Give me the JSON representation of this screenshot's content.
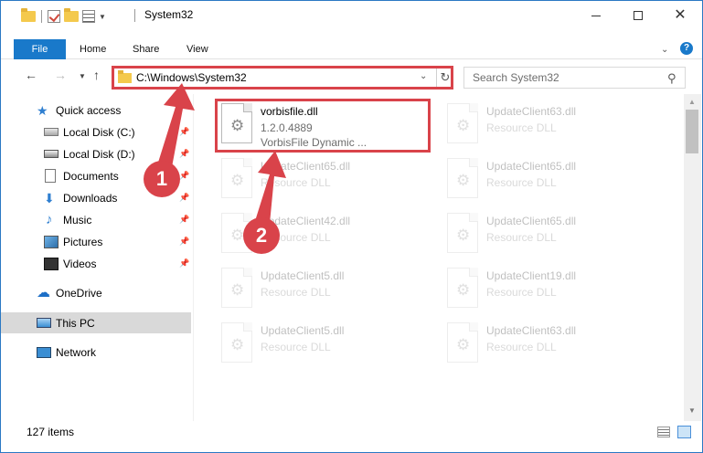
{
  "window": {
    "title": "System32"
  },
  "ribbon": {
    "tabs": [
      {
        "label": "File"
      },
      {
        "label": "Home"
      },
      {
        "label": "Share"
      },
      {
        "label": "View"
      }
    ]
  },
  "nav": {
    "address": "C:\\Windows\\System32",
    "search_placeholder": "Search System32"
  },
  "sidebar": {
    "items": [
      {
        "label": "Quick access",
        "icon": "star-icon"
      },
      {
        "label": "Local Disk (C:)",
        "icon": "disk-icon"
      },
      {
        "label": "Local Disk (D:)",
        "icon": "disk-icon"
      },
      {
        "label": "Documents",
        "icon": "documents-icon"
      },
      {
        "label": "Downloads",
        "icon": "downloads-icon"
      },
      {
        "label": "Music",
        "icon": "music-icon"
      },
      {
        "label": "Pictures",
        "icon": "pictures-icon"
      },
      {
        "label": "Videos",
        "icon": "videos-icon"
      },
      {
        "label": "OneDrive",
        "icon": "cloud-icon"
      },
      {
        "label": "This PC",
        "icon": "pc-icon"
      },
      {
        "label": "Network",
        "icon": "network-icon"
      }
    ]
  },
  "files": [
    {
      "name": "vorbisfile.dll",
      "line2": "1.2.0.4889",
      "line3": "VorbisFile Dynamic ..."
    },
    {
      "name": "UpdateClient63.dll",
      "line2": "Resource DLL"
    },
    {
      "name": "UpdateClient65.dll",
      "line2": "Resource DLL"
    },
    {
      "name": "UpdateClient65.dll",
      "line2": "Resource DLL"
    },
    {
      "name": "UpdateClient42.dll",
      "line2": "Resource DLL"
    },
    {
      "name": "UpdateClient65.dll",
      "line2": "Resource DLL"
    },
    {
      "name": "UpdateClient5.dll",
      "line2": "Resource DLL"
    },
    {
      "name": "UpdateClient19.dll",
      "line2": "Resource DLL"
    },
    {
      "name": "UpdateClient5.dll",
      "line2": "Resource DLL"
    },
    {
      "name": "UpdateClient63.dll",
      "line2": "Resource DLL"
    }
  ],
  "status": {
    "item_count": "127 items"
  },
  "annotations": {
    "step1": "1",
    "step2": "2",
    "color": "#d9434a"
  }
}
